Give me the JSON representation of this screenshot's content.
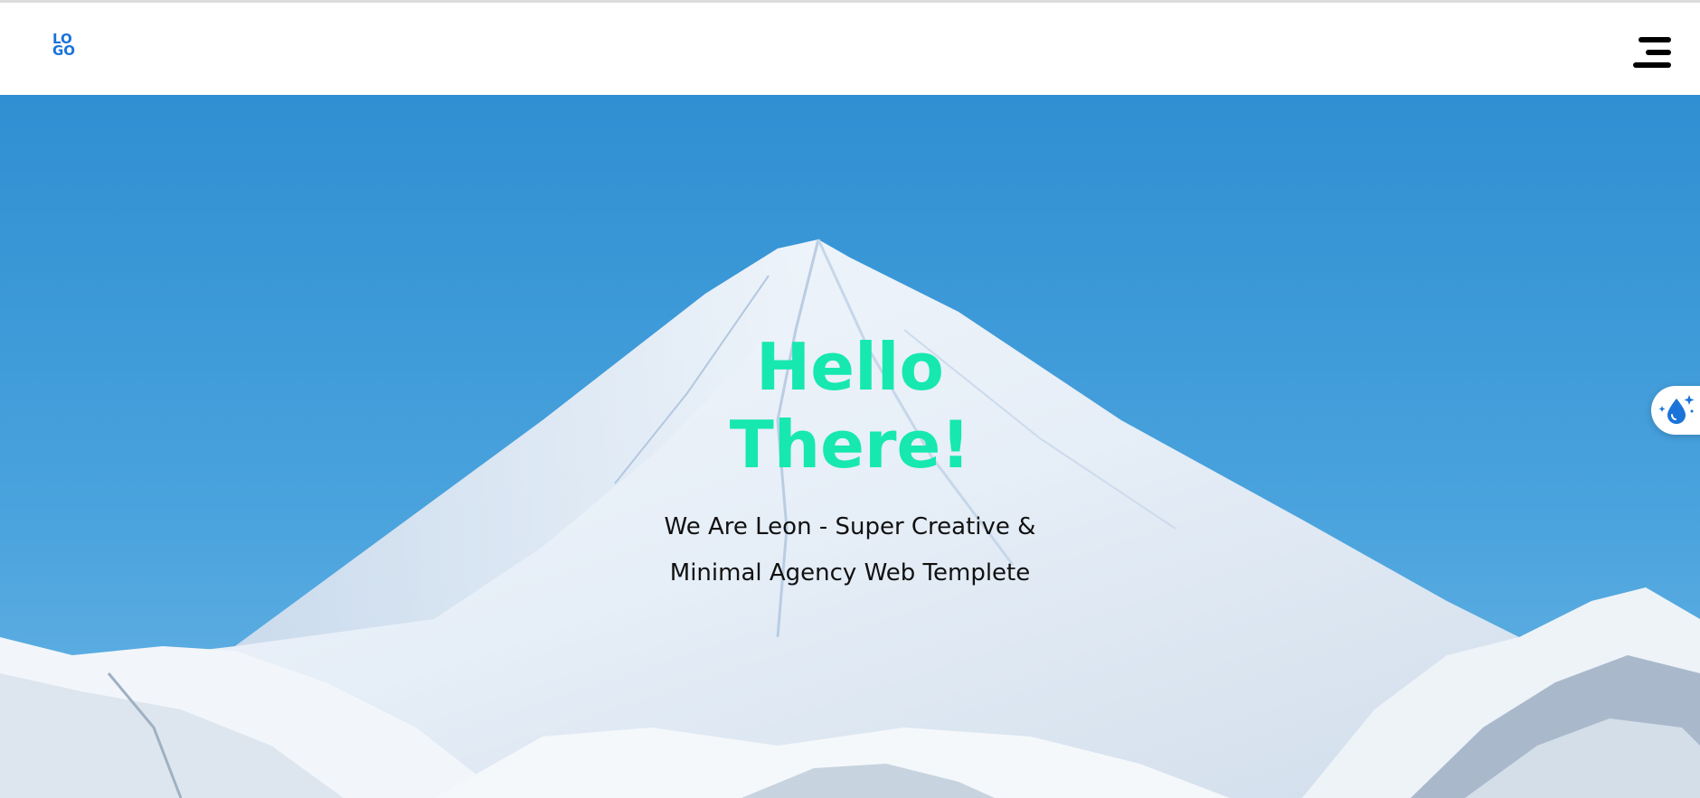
{
  "header": {
    "logo_line1": "LO",
    "logo_line2": "GO",
    "logo_color": "#1a73d9",
    "menu_icon": "hamburger-menu-icon"
  },
  "hero": {
    "title_line1": "Hello",
    "title_line2": "There!",
    "title_color": "#16e8b0",
    "subtitle": "We Are Leon - Super Creative & Minimal Agency Web Templete",
    "background": "snowy-mountain-photo",
    "sky_color": "#3a9ad6"
  },
  "floating_widget": {
    "icon": "water-drop-sparkle-icon",
    "icon_color": "#1a73d9"
  }
}
